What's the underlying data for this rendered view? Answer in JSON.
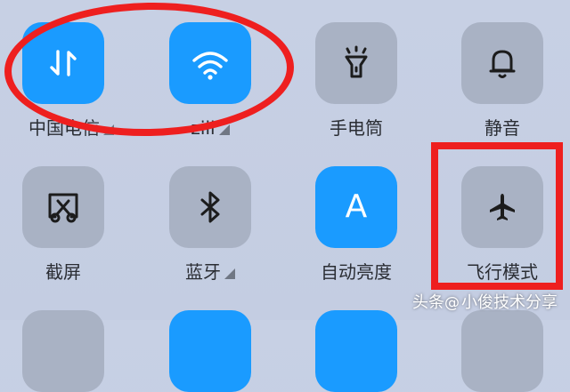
{
  "tiles": [
    {
      "name": "mobile-data",
      "label": "中国电信",
      "icon": "mobile-data-arrows-icon",
      "active": true,
      "has_dropdown": true
    },
    {
      "name": "wifi",
      "label": "ziii",
      "icon": "wifi-icon",
      "active": true,
      "has_dropdown": true
    },
    {
      "name": "flashlight",
      "label": "手电筒",
      "icon": "flashlight-icon",
      "active": false,
      "has_dropdown": false
    },
    {
      "name": "mute",
      "label": "静音",
      "icon": "bell-icon",
      "active": false,
      "has_dropdown": false
    },
    {
      "name": "screenshot",
      "label": "截屏",
      "icon": "scissors-screenshot-icon",
      "active": false,
      "has_dropdown": false
    },
    {
      "name": "bluetooth",
      "label": "蓝牙",
      "icon": "bluetooth-icon",
      "active": false,
      "has_dropdown": true
    },
    {
      "name": "auto-brightness",
      "label": "自动亮度",
      "icon": "letter-a-icon",
      "icon_text": "A",
      "active": true,
      "has_dropdown": false
    },
    {
      "name": "airplane-mode",
      "label": "飞行模式",
      "icon": "airplane-icon",
      "active": false,
      "has_dropdown": false
    }
  ],
  "watermark": {
    "prefix": "头条",
    "at": "@",
    "author": "小俊技术分享"
  },
  "colors": {
    "active_tile": "#1a9bff",
    "inactive_tile": "#a9b2c4",
    "background": "#c5cee3",
    "annotation": "#ee1f1f"
  }
}
